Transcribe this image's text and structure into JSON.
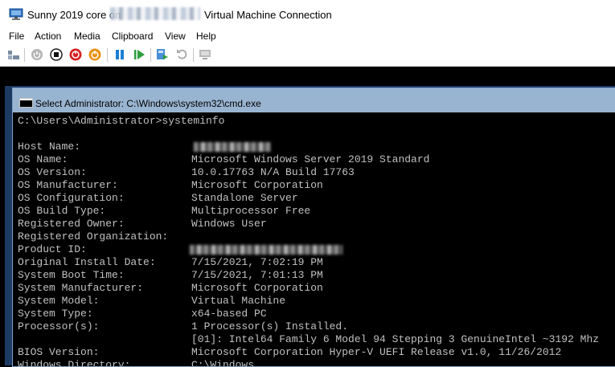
{
  "window": {
    "title_prefix": "Sunny 2019 core on",
    "title_suffix": "Virtual Machine Connection"
  },
  "menu": [
    "File",
    "Action",
    "Media",
    "Clipboard",
    "View",
    "Help"
  ],
  "toolbar": {
    "icons": [
      "ctrl-alt-del-icon",
      "start-icon",
      "turn-off-icon",
      "shut-down-icon",
      "save-icon",
      "pause-icon",
      "reset-icon",
      "checkpoint-icon",
      "revert-icon",
      "enhanced-session-icon"
    ]
  },
  "cmd": {
    "title": "Select Administrator: C:\\Windows\\system32\\cmd.exe",
    "prompt": "C:\\Users\\Administrator>systeminfo",
    "rows": [
      {
        "label": "Host Name:",
        "value": ""
      },
      {
        "label": "OS Name:",
        "value": "Microsoft Windows Server 2019 Standard"
      },
      {
        "label": "OS Version:",
        "value": "10.0.17763 N/A Build 17763"
      },
      {
        "label": "OS Manufacturer:",
        "value": "Microsoft Corporation"
      },
      {
        "label": "OS Configuration:",
        "value": "Standalone Server"
      },
      {
        "label": "OS Build Type:",
        "value": "Multiprocessor Free"
      },
      {
        "label": "Registered Owner:",
        "value": "Windows User"
      },
      {
        "label": "Registered Organization:",
        "value": ""
      },
      {
        "label": "Product ID:",
        "value": ""
      },
      {
        "label": "Original Install Date:",
        "value": "7/15/2021, 7:02:19 PM"
      },
      {
        "label": "System Boot Time:",
        "value": "7/15/2021, 7:01:13 PM"
      },
      {
        "label": "System Manufacturer:",
        "value": "Microsoft Corporation"
      },
      {
        "label": "System Model:",
        "value": "Virtual Machine"
      },
      {
        "label": "System Type:",
        "value": "x64-based PC"
      },
      {
        "label": "Processor(s):",
        "value": "1 Processor(s) Installed."
      },
      {
        "label": "",
        "value": "[01]: Intel64 Family 6 Model 94 Stepping 3 GenuineIntel ~3192 Mhz"
      },
      {
        "label": "BIOS Version:",
        "value": "Microsoft Corporation Hyper-V UEFI Release v1.0, 11/26/2012"
      },
      {
        "label": "Windows Directory:",
        "value": "C:\\Windows"
      }
    ]
  },
  "colors": {
    "console_text": "#c0c0c0",
    "cmd_titlebar": "#99b4d1",
    "desktop": "#1d3a63"
  }
}
